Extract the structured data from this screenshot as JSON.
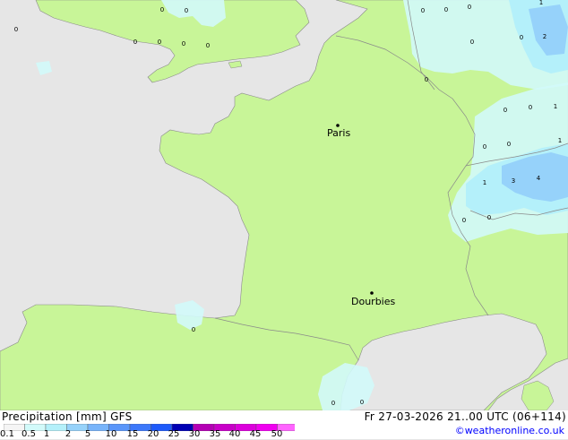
{
  "legend": {
    "title": "Precipitation [mm]  GFS",
    "run": "Fr 27-03-2026 21..00 UTC (06+114)",
    "credit": "©weatheronline.co.uk",
    "scale_labels": [
      "0.1",
      "0.5",
      "1",
      "2",
      "5",
      "10",
      "15",
      "20",
      "25",
      "30",
      "35",
      "40",
      "45",
      "50"
    ],
    "scale_colors": [
      "#f5f5f5",
      "#d2fafa",
      "#b4f0fa",
      "#96d2fa",
      "#78b4fa",
      "#5a96fa",
      "#3c78fa",
      "#1e5afa",
      "#0000b4",
      "#b400b4",
      "#c800c8",
      "#dc00dc",
      "#f000f0",
      "#ff64ff"
    ]
  },
  "cities": [
    {
      "name": "Paris"
    },
    {
      "name": "Dourbies"
    }
  ],
  "precip_values": [
    "0",
    "0",
    "0",
    "0",
    "0",
    "0",
    "0",
    "0",
    "0",
    "0",
    "0",
    "1",
    "2",
    "1",
    "0",
    "0",
    "0",
    "0",
    "0",
    "1",
    "3",
    "4",
    "1",
    "0",
    "0",
    "0",
    "0",
    "0",
    "0"
  ],
  "colors": {
    "land": "#c8f598",
    "sea": "#e6e6e6",
    "precip_light": "#d2fafa",
    "precip_mid": "#b4f0fa",
    "precip_high": "#96d2fa",
    "border": "#8a8a8a"
  }
}
